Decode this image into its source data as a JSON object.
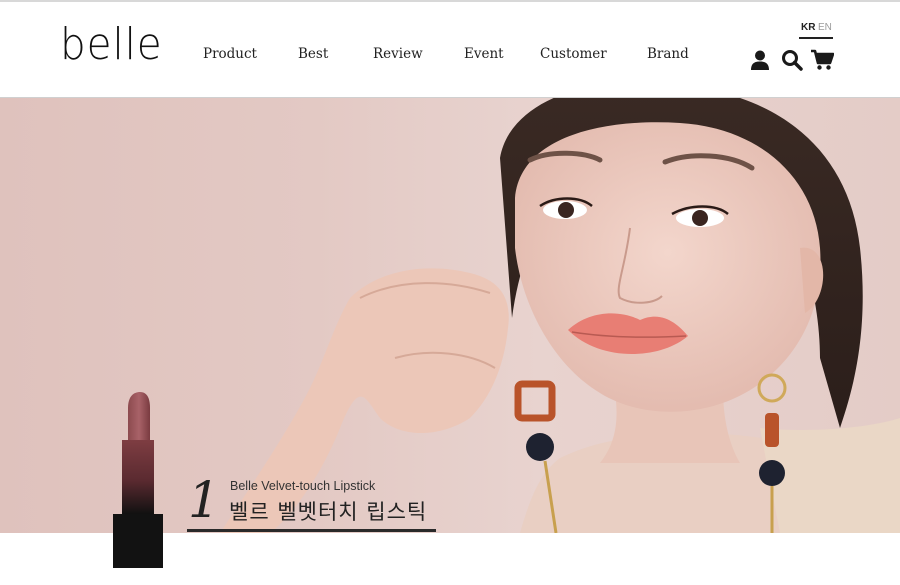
{
  "brand": {
    "logo_text": "belle"
  },
  "nav": {
    "items": [
      {
        "label": "Product"
      },
      {
        "label": "Best"
      },
      {
        "label": "Review"
      },
      {
        "label": "Event"
      },
      {
        "label": "Customer"
      },
      {
        "label": "Brand"
      }
    ]
  },
  "language": {
    "active": "KR",
    "other": "EN"
  },
  "icons": {
    "account": "user-icon",
    "search": "search-icon",
    "cart": "cart-icon"
  },
  "hero": {
    "number": "1",
    "subtitle": "Belle Velvet-touch Lipstick",
    "title": "벨르 벨벳터치 립스틱"
  },
  "colors": {
    "accent": "#222222",
    "hero_bg": "#e2c8c3",
    "lipstick": "#8c4a4e"
  }
}
